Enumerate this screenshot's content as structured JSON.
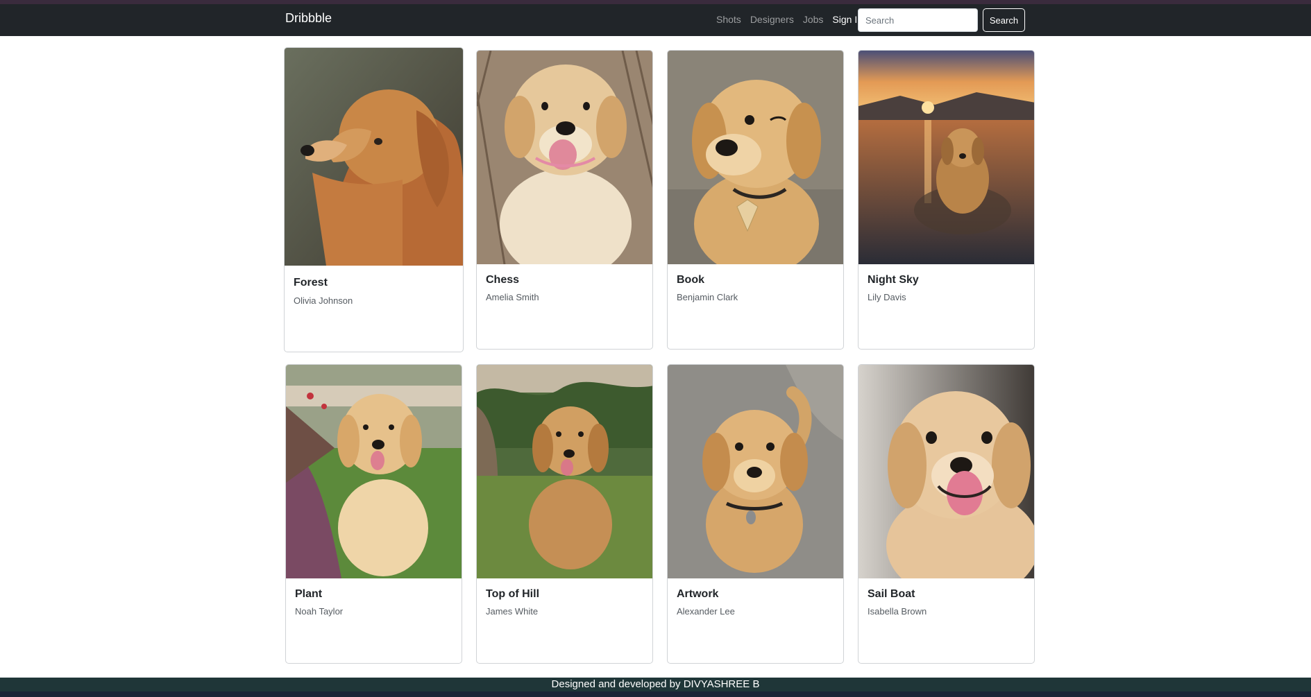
{
  "navbar": {
    "brand": "Dribbble",
    "links": [
      {
        "label": "Shots",
        "active": false
      },
      {
        "label": "Designers",
        "active": false
      },
      {
        "label": "Jobs",
        "active": false
      },
      {
        "label": "Sign In",
        "active": true
      }
    ],
    "search_placeholder": "Search",
    "search_button": "Search"
  },
  "cards": [
    {
      "title": "Forest",
      "author": "Olivia Johnson",
      "icon": "dog-portrait-image"
    },
    {
      "title": "Chess",
      "author": "Amelia Smith",
      "icon": "puppy-on-deck-image"
    },
    {
      "title": "Book",
      "author": "Benjamin Clark",
      "icon": "puppy-winking-image"
    },
    {
      "title": "Night Sky",
      "author": "Lily Davis",
      "icon": "dog-in-lake-sunset-image"
    },
    {
      "title": "Plant",
      "author": "Noah Taylor",
      "icon": "puppy-in-garden-image"
    },
    {
      "title": "Top of Hill",
      "author": "James White",
      "icon": "puppy-on-grass-image"
    },
    {
      "title": "Artwork",
      "author": "Alexander Lee",
      "icon": "puppy-on-pavement-image"
    },
    {
      "title": "Sail Boat",
      "author": "Isabella Brown",
      "icon": "puppy-smiling-image"
    }
  ],
  "footer": {
    "text": "Designed and developed by DIVYASHREE B"
  },
  "colors": {
    "navbar_bg": "#212529",
    "footer_bg": "#1f3638",
    "golden_fur": "#d9a86a"
  }
}
